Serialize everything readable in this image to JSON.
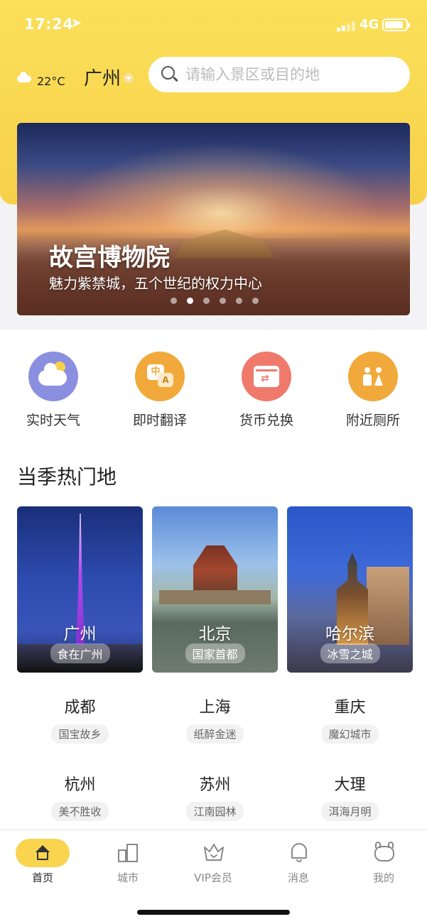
{
  "status_bar": {
    "time": "17:24",
    "network": "4G",
    "battery_level": 0.9
  },
  "header": {
    "weather_temp": "22°C",
    "city": "广州",
    "search_placeholder": "请输入景区或目的地"
  },
  "banner": {
    "title": "故宫博物院",
    "subtitle": "魅力紫禁城，五个世纪的权力中心",
    "dot_count": 6,
    "active_dot": 1
  },
  "quick_tools": [
    {
      "label": "实时天气",
      "icon": "weather-icon",
      "color": "#8b8fe0"
    },
    {
      "label": "即时翻译",
      "icon": "translate-icon",
      "color": "#f0a93a"
    },
    {
      "label": "货币兑换",
      "icon": "currency-exchange-icon",
      "color": "#ef7a6b"
    },
    {
      "label": "附近厕所",
      "icon": "toilet-icon",
      "color": "#f0a93a"
    }
  ],
  "section_title": "当季热门地",
  "featured_cities": [
    {
      "name": "广州",
      "tag": "食在广州"
    },
    {
      "name": "北京",
      "tag": "国家首都"
    },
    {
      "name": "哈尔滨",
      "tag": "冰雪之城"
    }
  ],
  "cities": [
    {
      "name": "成都",
      "tag": "国宝故乡"
    },
    {
      "name": "上海",
      "tag": "纸醉金迷"
    },
    {
      "name": "重庆",
      "tag": "魔幻城市"
    },
    {
      "name": "杭州",
      "tag": "美不胜收"
    },
    {
      "name": "苏州",
      "tag": "江南园林"
    },
    {
      "name": "大理",
      "tag": "洱海月明"
    }
  ],
  "tab_bar": [
    {
      "label": "首页",
      "icon": "home-icon",
      "active": true
    },
    {
      "label": "城市",
      "icon": "city-icon",
      "active": false
    },
    {
      "label": "VIP会员",
      "icon": "vip-crown-icon",
      "active": false
    },
    {
      "label": "消息",
      "icon": "bell-icon",
      "active": false
    },
    {
      "label": "我的",
      "icon": "profile-icon",
      "active": false
    }
  ],
  "colors": {
    "brand_yellow": "#f9d44e",
    "header_yellow": "#fbe05a"
  }
}
